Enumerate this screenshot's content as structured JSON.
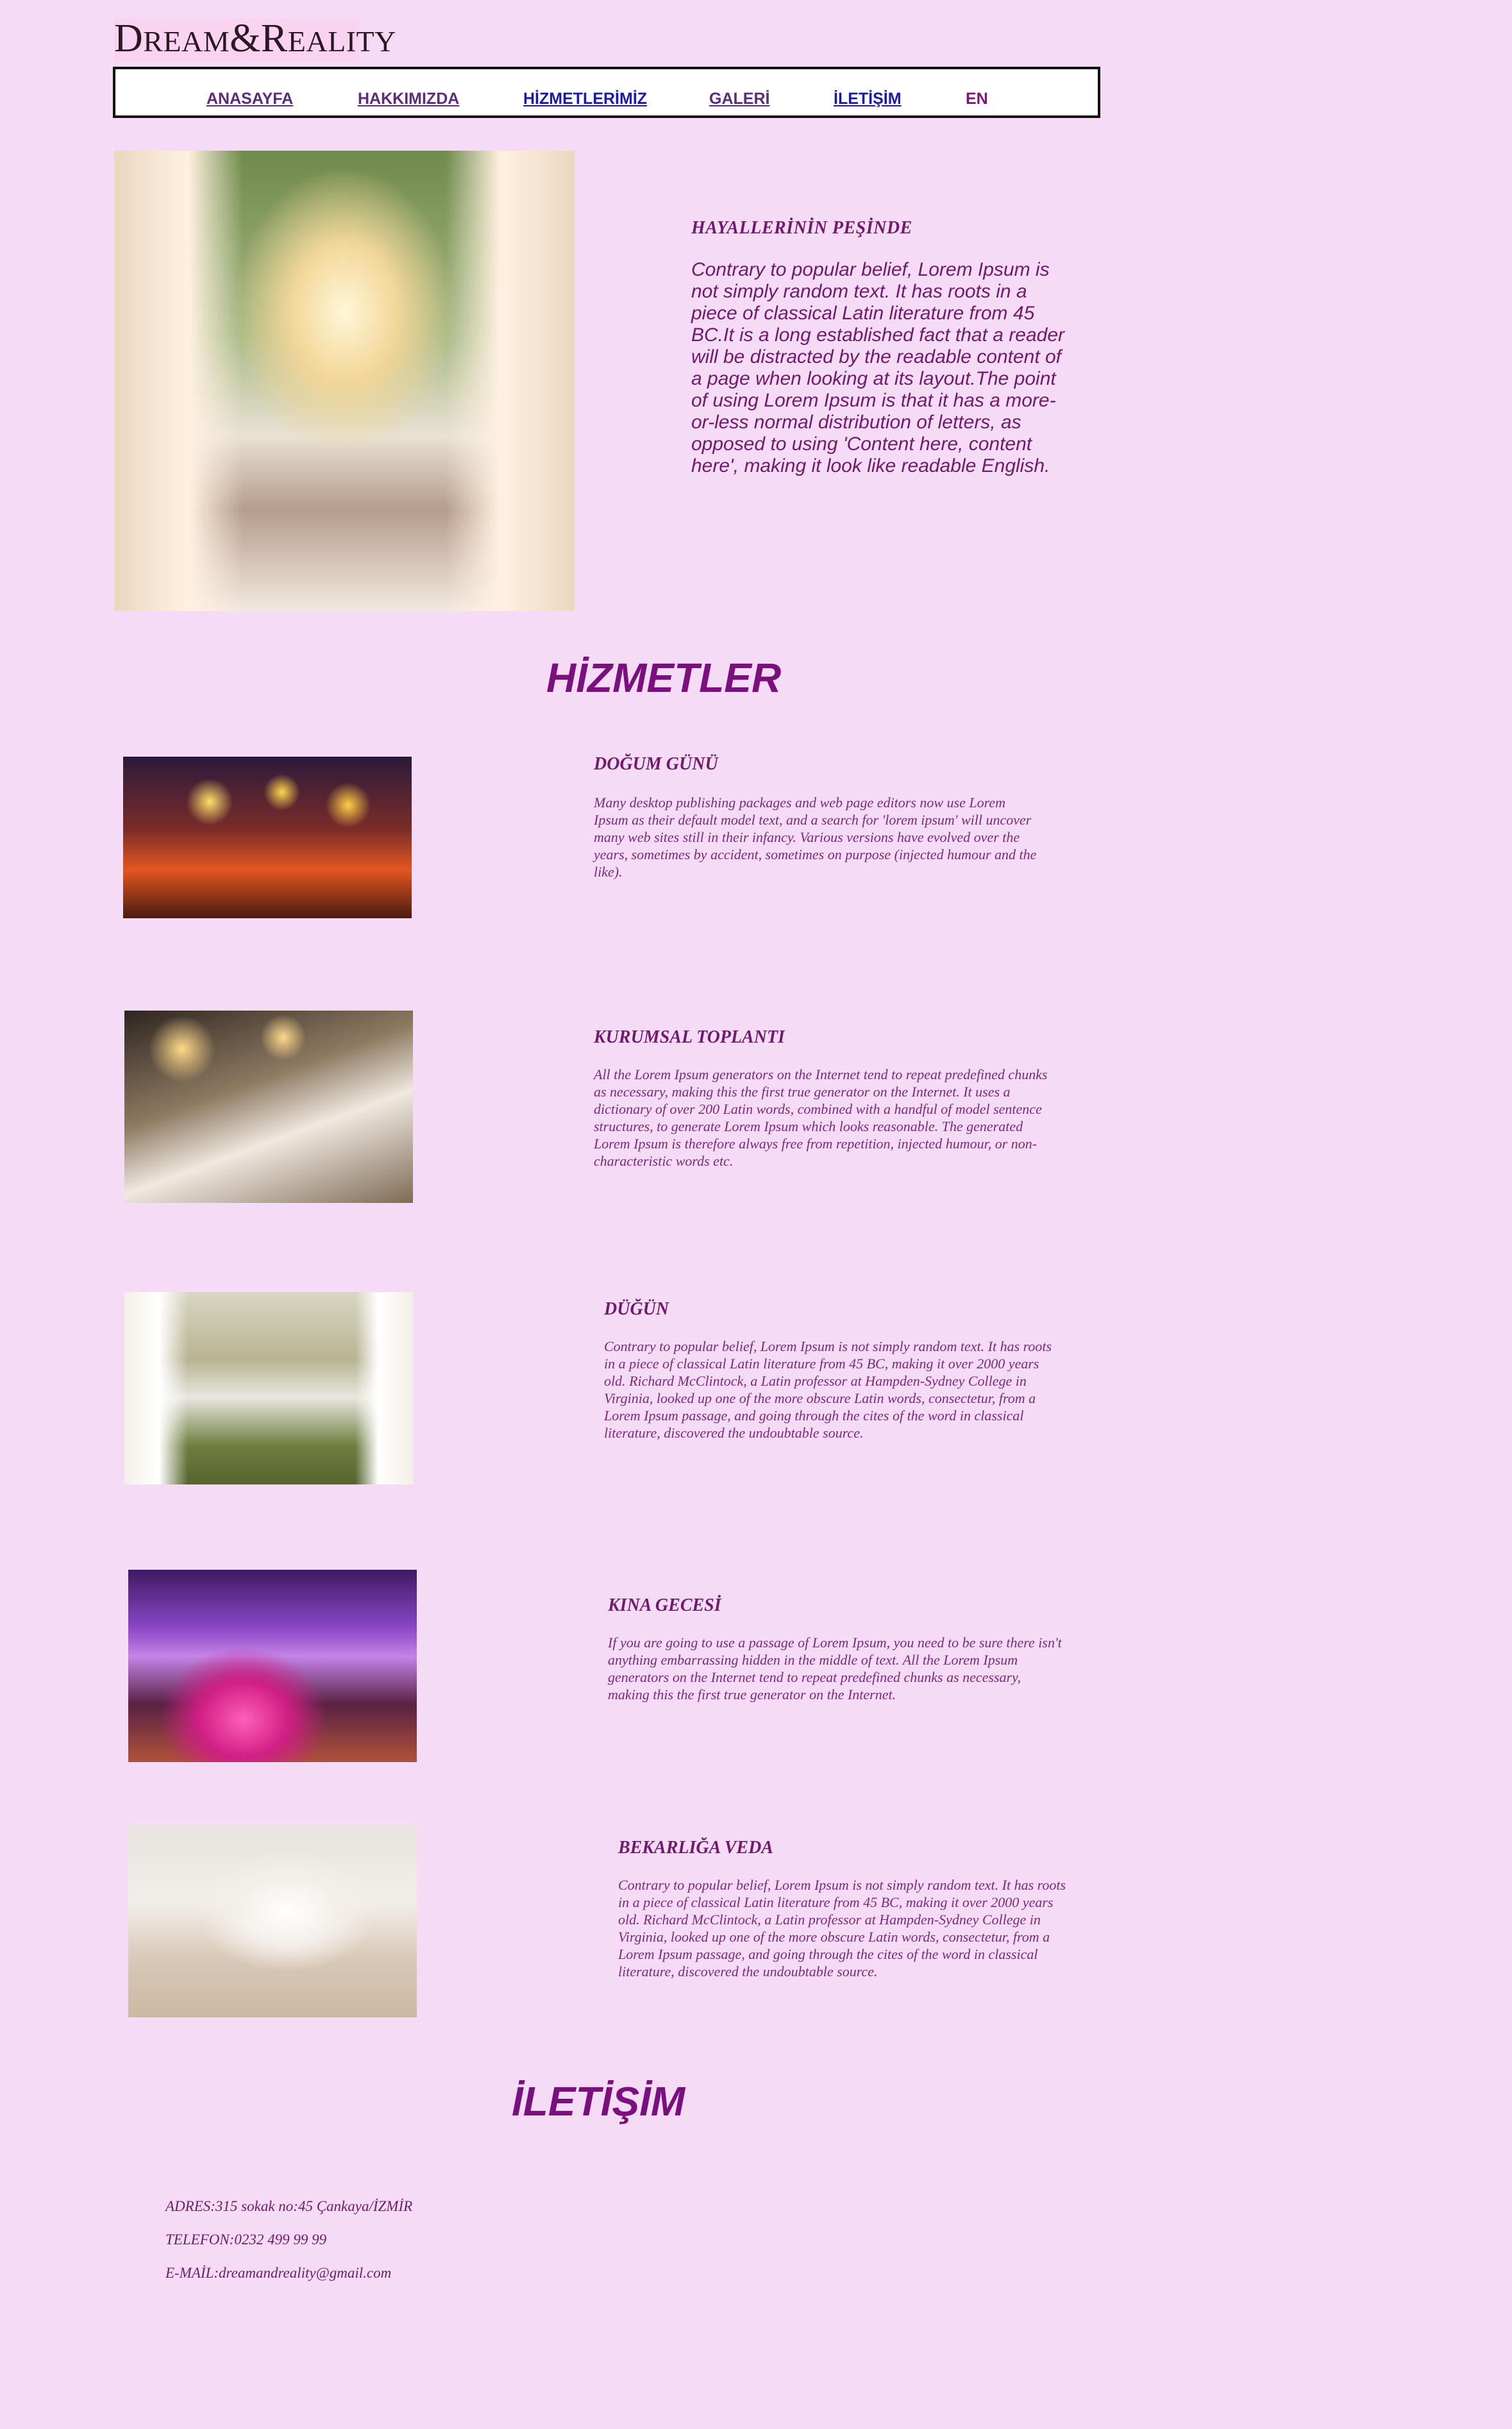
{
  "logo": {
    "text_big1": "D",
    "text_small1": "REAM",
    "text_mid": "&",
    "text_big2": "R",
    "text_small2": "EALITY"
  },
  "nav": {
    "items": [
      "ANASAYFA",
      "HAKKIMIZDA",
      "HİZMETLERİMİZ",
      "GALERİ",
      "İLETİŞİM",
      "EN"
    ]
  },
  "hero": {
    "heading": "HAYALLERİNİN PEŞİNDE",
    "body": "Contrary to popular belief, Lorem Ipsum is not simply random text. It has roots in a piece of classical Latin literature from 45 BC.It is a long established fact that a reader will be distracted by the readable content of a page when looking at its layout.The point of using Lorem Ipsum is that it has a more-or-less normal distribution of letters, as opposed to using 'Content here, content here', making it look like readable English."
  },
  "services": {
    "title": "HİZMETLER",
    "items": [
      {
        "title": "DOĞUM GÜNÜ",
        "body": "Many desktop publishing packages and web page editors now use Lorem Ipsum as their default model text, and a search for 'lorem ipsum' will uncover many web sites still in their infancy. Various versions have evolved over the years, sometimes by accident, sometimes on purpose (injected humour and the like)."
      },
      {
        "title": "KURUMSAL TOPLANTI",
        "body": "All the Lorem Ipsum generators on the Internet tend to repeat predefined chunks as necessary, making this the first true generator on the Internet. It uses a dictionary of over 200 Latin words, combined with a handful of model sentence structures, to generate Lorem Ipsum which looks reasonable. The generated Lorem Ipsum is therefore always free from repetition, injected humour, or non-characteristic words etc."
      },
      {
        "title": "DÜĞÜN",
        "body": "Contrary to popular belief, Lorem Ipsum is not simply random text. It has roots in a piece of classical Latin literature from 45 BC, making it over 2000 years old. Richard McClintock, a Latin professor at Hampden-Sydney College in Virginia, looked up one of the more obscure Latin words, consectetur, from a Lorem Ipsum passage, and going through the cites of the word in classical literature, discovered the undoubtable source."
      },
      {
        "title": "KINA GECESİ",
        "body": "If you are going to use a passage of Lorem Ipsum, you need to be sure there isn't anything embarrassing hidden in the middle of text. All the Lorem Ipsum generators on the Internet tend to repeat predefined chunks as necessary, making this the first true generator on the Internet."
      },
      {
        "title": "BEKARLIĞA VEDA",
        "body": "Contrary to popular belief, Lorem Ipsum is not simply random text. It has roots in a piece of classical Latin literature from 45 BC, making it over 2000 years old. Richard McClintock, a Latin professor at Hampden-Sydney College in Virginia, looked up one of the more obscure Latin words, consectetur, from a Lorem Ipsum passage, and going through the cites of the word in classical literature, discovered the undoubtable source."
      }
    ]
  },
  "contact": {
    "title": "İLETİŞİM",
    "address": "ADRES:315 sokak no:45 Çankaya/İZMİR",
    "phone": "TELEFON:0232 499 99 99",
    "email": "E-MAİL:dreamandreality@gmail.com"
  },
  "colors": {
    "background": "#f5dbf6",
    "accent": "#7a0f7e",
    "text": "#6d1b6a"
  }
}
